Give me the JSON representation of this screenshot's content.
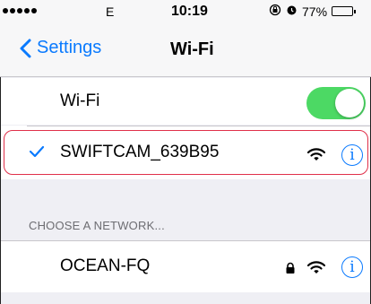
{
  "status_bar": {
    "carrier": "E",
    "time": "10:19",
    "battery_percent": "77%",
    "battery_level": 0.77,
    "icons": [
      "signal-dots-icon",
      "rotation-lock-icon",
      "alarm-icon",
      "battery-icon"
    ]
  },
  "nav": {
    "back_label": "Settings",
    "title": "Wi-Fi"
  },
  "wifi_toggle": {
    "label": "Wi-Fi",
    "on": true
  },
  "connected_network": {
    "name": "SWIFTCAM_639B95",
    "info_glyph": "i"
  },
  "section_header": "CHOOSE A NETWORK...",
  "networks": [
    {
      "name": "OCEAN-FQ",
      "locked": true,
      "info_glyph": "i"
    }
  ],
  "colors": {
    "accent": "#0a7afe",
    "toggle_on": "#4cd964",
    "highlight_border": "#e0304a"
  }
}
